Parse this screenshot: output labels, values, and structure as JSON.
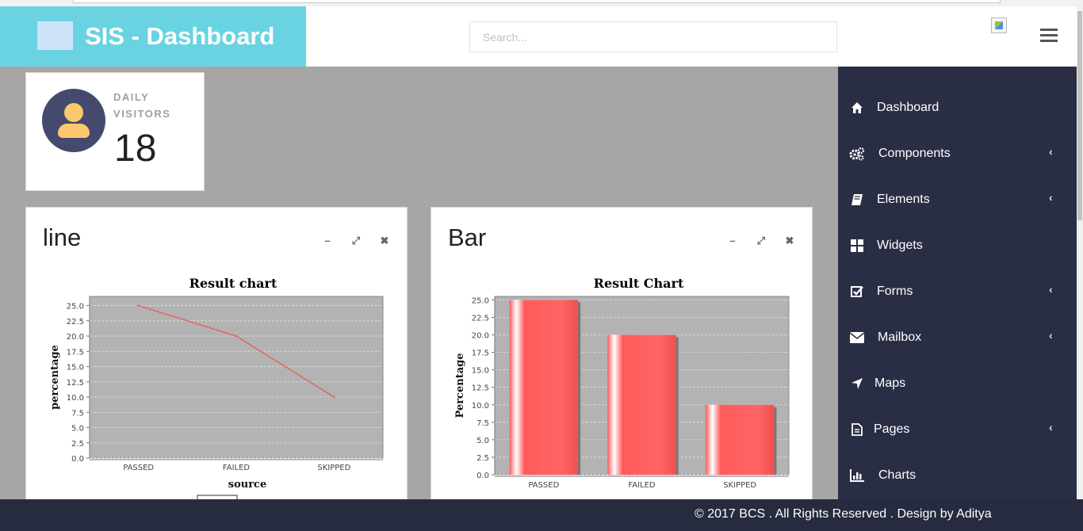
{
  "header": {
    "brand_title": "SIS - Dashboard",
    "search_placeholder": "Search...",
    "accent_color": "#69d3e2"
  },
  "visitors": {
    "label": "DAILY VISITORS",
    "count": "18"
  },
  "sidebar": {
    "bg_color": "#2a2e45",
    "items": [
      {
        "label": "Dashboard",
        "icon": "home-icon",
        "active": true
      },
      {
        "label": "Components",
        "icon": "cogs-icon",
        "has_submenu": true
      },
      {
        "label": "Elements",
        "icon": "book-icon",
        "has_submenu": true
      },
      {
        "label": "Widgets",
        "icon": "widgets-grid-icon"
      },
      {
        "label": "Forms",
        "icon": "check-square-icon",
        "has_submenu": true
      },
      {
        "label": "Mailbox",
        "icon": "envelope-icon",
        "has_submenu": true
      },
      {
        "label": "Maps",
        "icon": "location-arrow-icon"
      },
      {
        "label": "Pages",
        "icon": "file-icon",
        "has_submenu": true
      },
      {
        "label": "Charts",
        "icon": "bar-chart-icon"
      }
    ],
    "chevron": "‹"
  },
  "line_card": {
    "title": "line",
    "tools": [
      "minimize-icon",
      "expand-icon",
      "close-icon"
    ]
  },
  "bar_card": {
    "title": "Bar",
    "tools": [
      "minimize-icon",
      "expand-icon",
      "close-icon"
    ]
  },
  "footer": {
    "text": "© 2017 BCS . All Rights Reserved . Design by Aditya"
  },
  "chart_data": [
    {
      "type": "line",
      "title": "Result chart",
      "xlabel": "source",
      "ylabel": "percentage",
      "categories": [
        "PASSED",
        "FAILED",
        "SKIPPED"
      ],
      "values": [
        25,
        20,
        10
      ],
      "ylim": [
        0,
        26.5
      ],
      "yticks": [
        "0.0",
        "2.5",
        "5.0",
        "7.5",
        "10.0",
        "12.5",
        "15.0",
        "17.5",
        "20.0",
        "22.5",
        "25.0"
      ],
      "grid": true,
      "line_color": "#e8605a",
      "plot_bg": "#b3b3b3"
    },
    {
      "type": "bar",
      "title": "Result Chart",
      "ylabel": "Percentage",
      "categories": [
        "PASSED",
        "FAILED",
        "SKIPPED"
      ],
      "values": [
        25,
        20,
        10
      ],
      "ylim": [
        0,
        25.5
      ],
      "yticks": [
        "0.0",
        "2.5",
        "5.0",
        "7.5",
        "10.0",
        "12.5",
        "15.0",
        "17.5",
        "20.0",
        "22.5",
        "25.0"
      ],
      "grid": true,
      "bar_color": "#ff5a5a",
      "plot_bg": "#b3b3b3"
    }
  ]
}
